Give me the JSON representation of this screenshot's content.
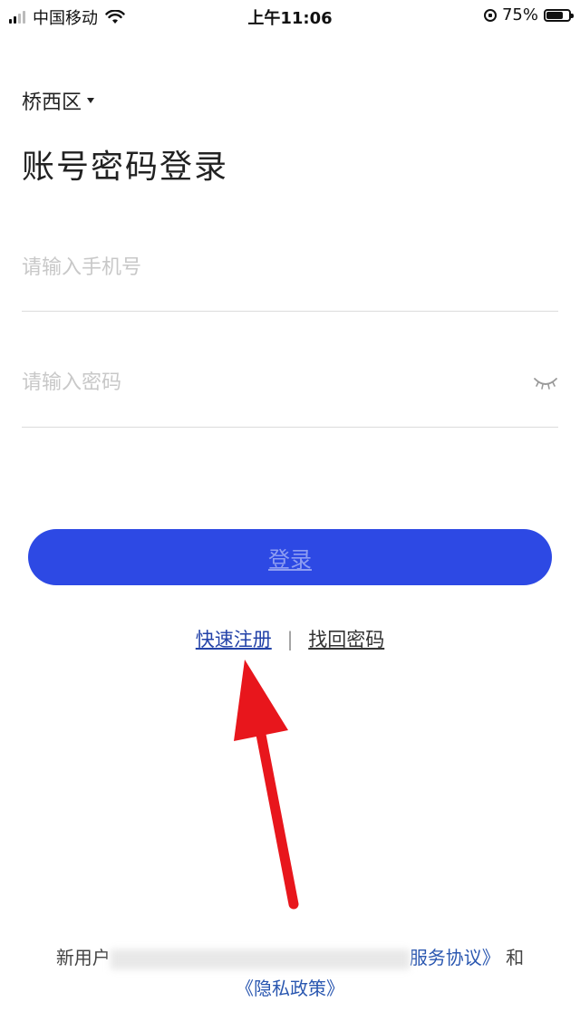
{
  "status_bar": {
    "carrier": "中国移动",
    "time": "上午11:06",
    "battery": "75%",
    "battery_level": 0.75
  },
  "region": {
    "label": "桥西区"
  },
  "page": {
    "title": "账号密码登录"
  },
  "form": {
    "phone_placeholder": "请输入手机号",
    "password_placeholder": "请输入密码",
    "eye_icon": "eye-closed-icon"
  },
  "login_button": {
    "label": "登录",
    "color": "#2d49e4"
  },
  "links": {
    "register": "快速注册",
    "separator": "|",
    "recover": "找回密码"
  },
  "agreement": {
    "prefix": "新用户",
    "service": "服务协议》",
    "and": "和",
    "privacy": "《隐私政策》"
  },
  "annotation": {
    "arrow_color": "#e8161c"
  }
}
